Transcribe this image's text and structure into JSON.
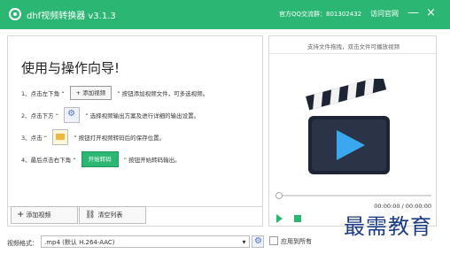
{
  "header": {
    "app_title": "dhf视频转换器 v3.1.3",
    "qq_group": "官方QQ交流群：801302432",
    "website": "访问官网",
    "minimize": "—",
    "close": "×"
  },
  "guide": {
    "title": "使用与操作向导!",
    "step1_text_before": "1、点击左下角 “",
    "step1_button": "+ 添加视频",
    "step1_text_after": "” 按钮添加视频文件，可多选视频。",
    "step2_text_before": "2、点击下方 “",
    "step2_text_after": "” 选择视频输出方案及进行详细的输出设置。",
    "step3_text_before": "3、点击 “",
    "step3_text_after": "” 按钮打开视频转码后的保存位置。",
    "step4_text_before": "4、最后点击右下角 “",
    "step4_button": "开始转码",
    "step4_text_after": "” 按钮开始转码输出。"
  },
  "left_toolbar": {
    "add_video": "添加视频",
    "clear_list": "清空列表"
  },
  "preview": {
    "hint": "支持文件拖拽，双击文件可播放视频",
    "time": "00:00:00 / 00:00:00"
  },
  "bottom": {
    "format_label": "视频格式：",
    "format_value": ".mp4 (默认 H.264-AAC)",
    "apply_all": "应用到所有"
  },
  "watermark": {
    "text": "最需教育"
  },
  "colors": {
    "accent": "#2bb673",
    "watermark": "#1b3d86"
  }
}
